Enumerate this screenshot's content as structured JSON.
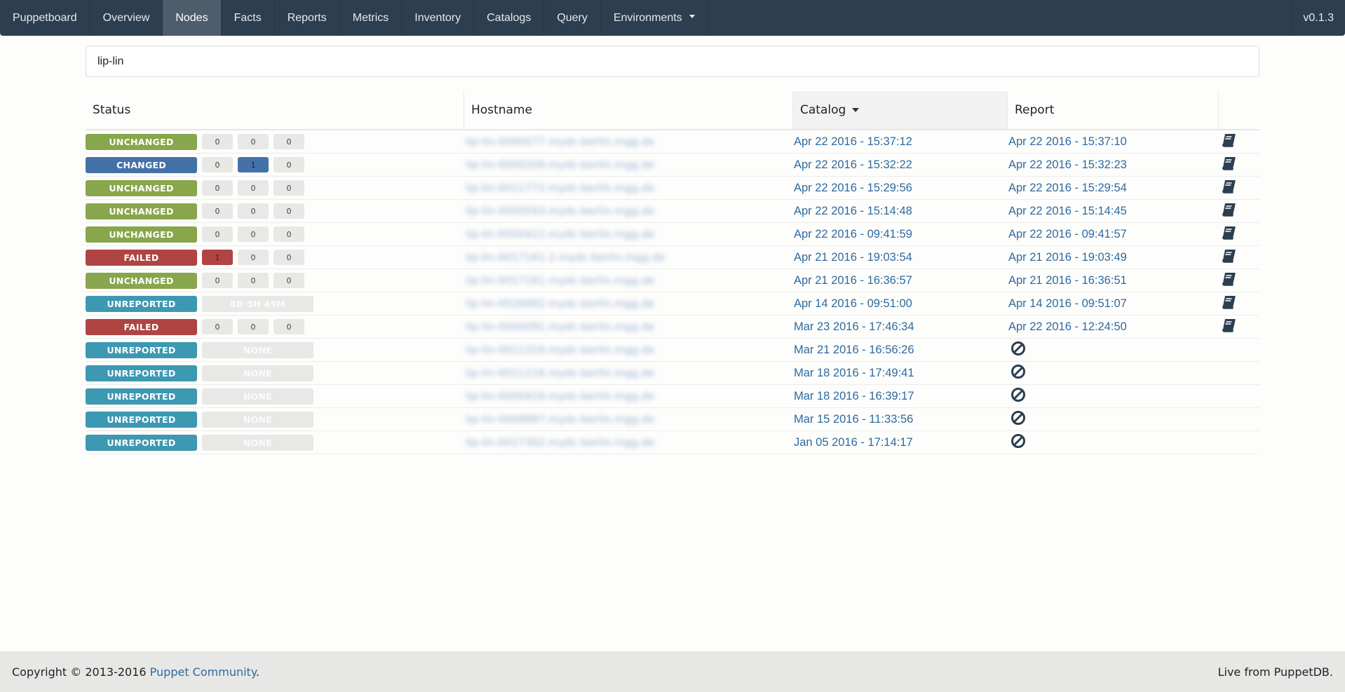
{
  "navbar": {
    "brand": "Puppetboard",
    "items": [
      {
        "label": "Overview",
        "active": false
      },
      {
        "label": "Nodes",
        "active": true
      },
      {
        "label": "Facts",
        "active": false
      },
      {
        "label": "Reports",
        "active": false
      },
      {
        "label": "Metrics",
        "active": false
      },
      {
        "label": "Inventory",
        "active": false
      },
      {
        "label": "Catalogs",
        "active": false
      },
      {
        "label": "Query",
        "active": false
      }
    ],
    "dropdown_label": "Environments",
    "version": "v0.1.3"
  },
  "search": {
    "value": "lip-lin",
    "placeholder": ""
  },
  "table": {
    "headers": {
      "status": "Status",
      "hostname": "Hostname",
      "catalog": "Catalog",
      "report": "Report"
    },
    "sorted_by": "catalog",
    "sort_direction": "desc",
    "colors": {
      "unchanged": "#88a64b",
      "changed": "#4472a8",
      "failed": "#b04443",
      "unreported": "#3d98b2",
      "link": "#2e6a9e"
    },
    "rows": [
      {
        "status": "UNCHANGED",
        "counts": [
          "0",
          "0",
          "0"
        ],
        "hostname": "lip-lin-0000077.mydc-berlin.mgg.de",
        "catalog": "Apr 22 2016 - 15:37:12",
        "report": "Apr 22 2016 - 15:37:10",
        "report_icon": "book-icon"
      },
      {
        "status": "CHANGED",
        "counts": [
          "0",
          "1",
          "0"
        ],
        "hostname": "lip-lin-0000209.mydc-berlin.mgg.de",
        "catalog": "Apr 22 2016 - 15:32:22",
        "report": "Apr 22 2016 - 15:32:23",
        "report_icon": "book-icon"
      },
      {
        "status": "UNCHANGED",
        "counts": [
          "0",
          "0",
          "0"
        ],
        "hostname": "lip-lin-0011772.mydc-berlin.mgg.de",
        "catalog": "Apr 22 2016 - 15:29:56",
        "report": "Apr 22 2016 - 15:29:54",
        "report_icon": "book-icon"
      },
      {
        "status": "UNCHANGED",
        "counts": [
          "0",
          "0",
          "0"
        ],
        "hostname": "lip-lin-0000593.mydc-berlin.mgg.de",
        "catalog": "Apr 22 2016 - 15:14:48",
        "report": "Apr 22 2016 - 15:14:45",
        "report_icon": "book-icon"
      },
      {
        "status": "UNCHANGED",
        "counts": [
          "0",
          "0",
          "0"
        ],
        "hostname": "lip-lin-0000412.mydc-berlin.mgg.de",
        "catalog": "Apr 22 2016 - 09:41:59",
        "report": "Apr 22 2016 - 09:41:57",
        "report_icon": "book-icon"
      },
      {
        "status": "FAILED",
        "counts": [
          "1",
          "0",
          "0"
        ],
        "hostname": "lip-lin-0017161-2.mydc-berlin.mgg.de",
        "catalog": "Apr 21 2016 - 19:03:54",
        "report": "Apr 21 2016 - 19:03:49",
        "report_icon": "book-icon"
      },
      {
        "status": "UNCHANGED",
        "counts": [
          "0",
          "0",
          "0"
        ],
        "hostname": "lip-lin-0017161.mydc-berlin.mgg.de",
        "catalog": "Apr 21 2016 - 16:36:57",
        "report": "Apr 21 2016 - 16:36:51",
        "report_icon": "book-icon"
      },
      {
        "status": "UNREPORTED",
        "duration": "8D 5H 49M",
        "hostname": "lip-lin-0026992.mydc-berlin.mgg.de",
        "catalog": "Apr 14 2016 - 09:51:00",
        "report": "Apr 14 2016 - 09:51:07",
        "report_icon": "book-icon"
      },
      {
        "status": "FAILED",
        "counts": [
          "0",
          "0",
          "0"
        ],
        "hostname": "lip-lin-0000091.mydc-berlin.mgg.de",
        "catalog": "Mar 23 2016 - 17:46:34",
        "report": "Apr 22 2016 - 12:24:50",
        "report_icon": "book-icon"
      },
      {
        "status": "UNREPORTED",
        "duration": "NONE",
        "hostname": "lip-lin-0011316.mydc-berlin.mgg.de",
        "catalog": "Mar 21 2016 - 16:56:26",
        "report": "",
        "report_icon": "ban-icon"
      },
      {
        "status": "UNREPORTED",
        "duration": "NONE",
        "hostname": "lip-lin-0011216.mydc-berlin.mgg.de",
        "catalog": "Mar 18 2016 - 17:49:41",
        "report": "",
        "report_icon": "ban-icon"
      },
      {
        "status": "UNREPORTED",
        "duration": "NONE",
        "hostname": "lip-lin-0000416.mydc-berlin.mgg.de",
        "catalog": "Mar 18 2016 - 16:39:17",
        "report": "",
        "report_icon": "ban-icon"
      },
      {
        "status": "UNREPORTED",
        "duration": "NONE",
        "hostname": "lip-lin-0008887.mydc-berlin.mgg.de",
        "catalog": "Mar 15 2016 - 11:33:56",
        "report": "",
        "report_icon": "ban-icon"
      },
      {
        "status": "UNREPORTED",
        "duration": "NONE",
        "hostname": "lip-lin-0017302.mydc-berlin.mgg.de",
        "catalog": "Jan 05 2016 - 17:14:17",
        "report": "",
        "report_icon": "ban-icon"
      }
    ]
  },
  "footer": {
    "copyright_prefix": "Copyright © 2013-2016 ",
    "link_text": "Puppet Community",
    "copyright_suffix": ".",
    "right_text": "Live from PuppetDB."
  }
}
